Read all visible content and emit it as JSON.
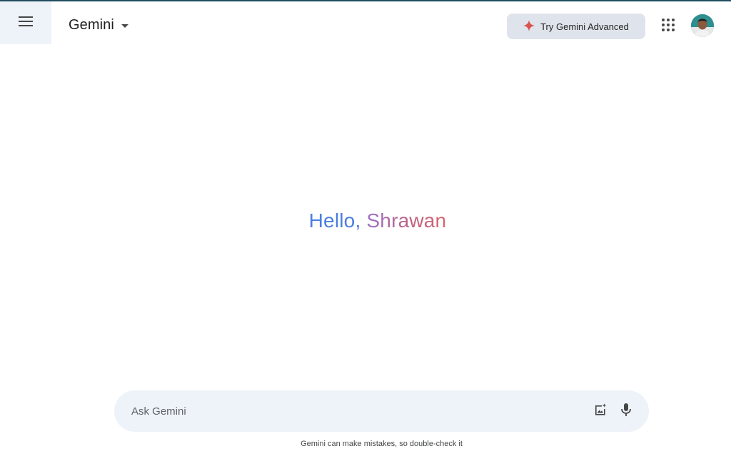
{
  "header": {
    "app_name": "Gemini",
    "advanced_button_label": "Try Gemini Advanced",
    "menu_icon": "hamburger-menu-icon",
    "dropdown_icon": "caret-down-icon",
    "sparkle_icon": "sparkle-icon",
    "apps_icon": "apps-grid-icon",
    "avatar": "user-avatar"
  },
  "main": {
    "greeting_hello": "Hello,",
    "greeting_name": "Shrawan"
  },
  "prompt": {
    "placeholder": "Ask Gemini",
    "value": "",
    "image_icon": "add-image-icon",
    "mic_icon": "microphone-icon"
  },
  "footer": {
    "disclaimer": "Gemini can make mistakes, so double-check it"
  },
  "colors": {
    "accent_blue": "#4a7ee0",
    "accent_rose": "#c0607a",
    "sparkle": "#d9534f",
    "surface": "#eef2f9",
    "button_bg": "#dfe3eb"
  }
}
